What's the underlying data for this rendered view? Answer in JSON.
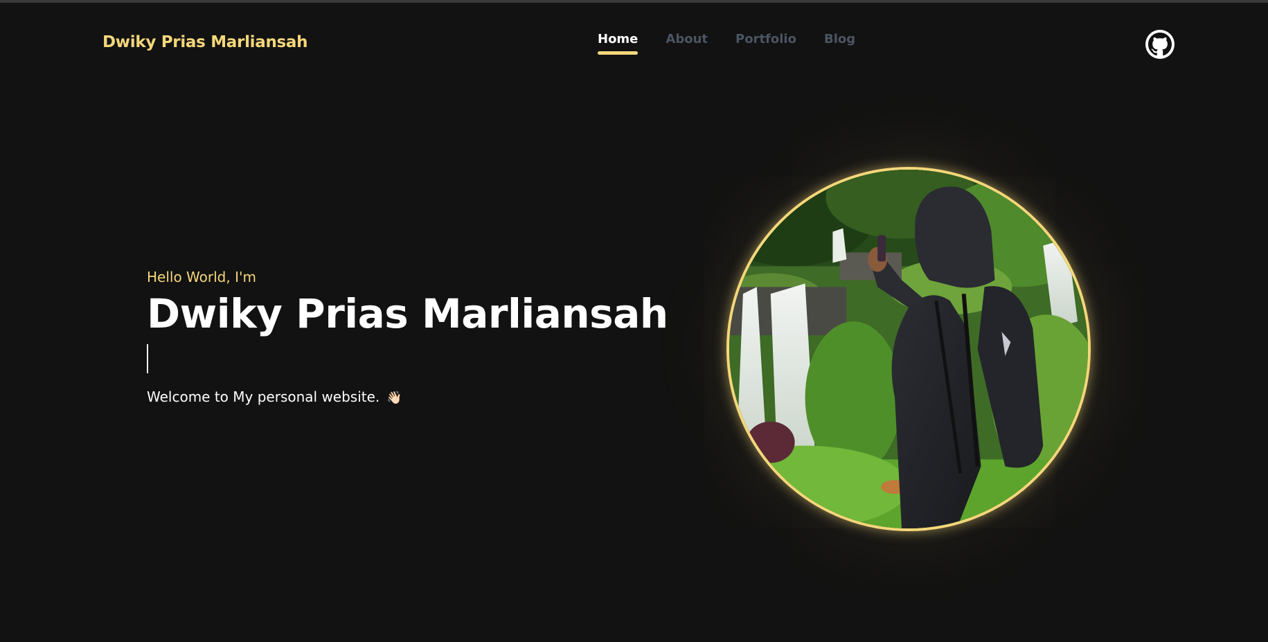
{
  "header": {
    "brand": "Dwiky Prias Marliansah",
    "nav": [
      {
        "label": "Home",
        "active": true
      },
      {
        "label": "About",
        "active": false
      },
      {
        "label": "Portfolio",
        "active": false
      },
      {
        "label": "Blog",
        "active": false
      }
    ],
    "github_icon": "github-icon"
  },
  "hero": {
    "greeting": "Hello World, I'm",
    "name": "Dwiky Prias Marliansah",
    "welcome": "Welcome to My personal website.",
    "wave_emoji": "👋🏻"
  },
  "colors": {
    "background": "#121212",
    "accent": "#f5d77a",
    "nav_inactive": "#4b5563"
  }
}
